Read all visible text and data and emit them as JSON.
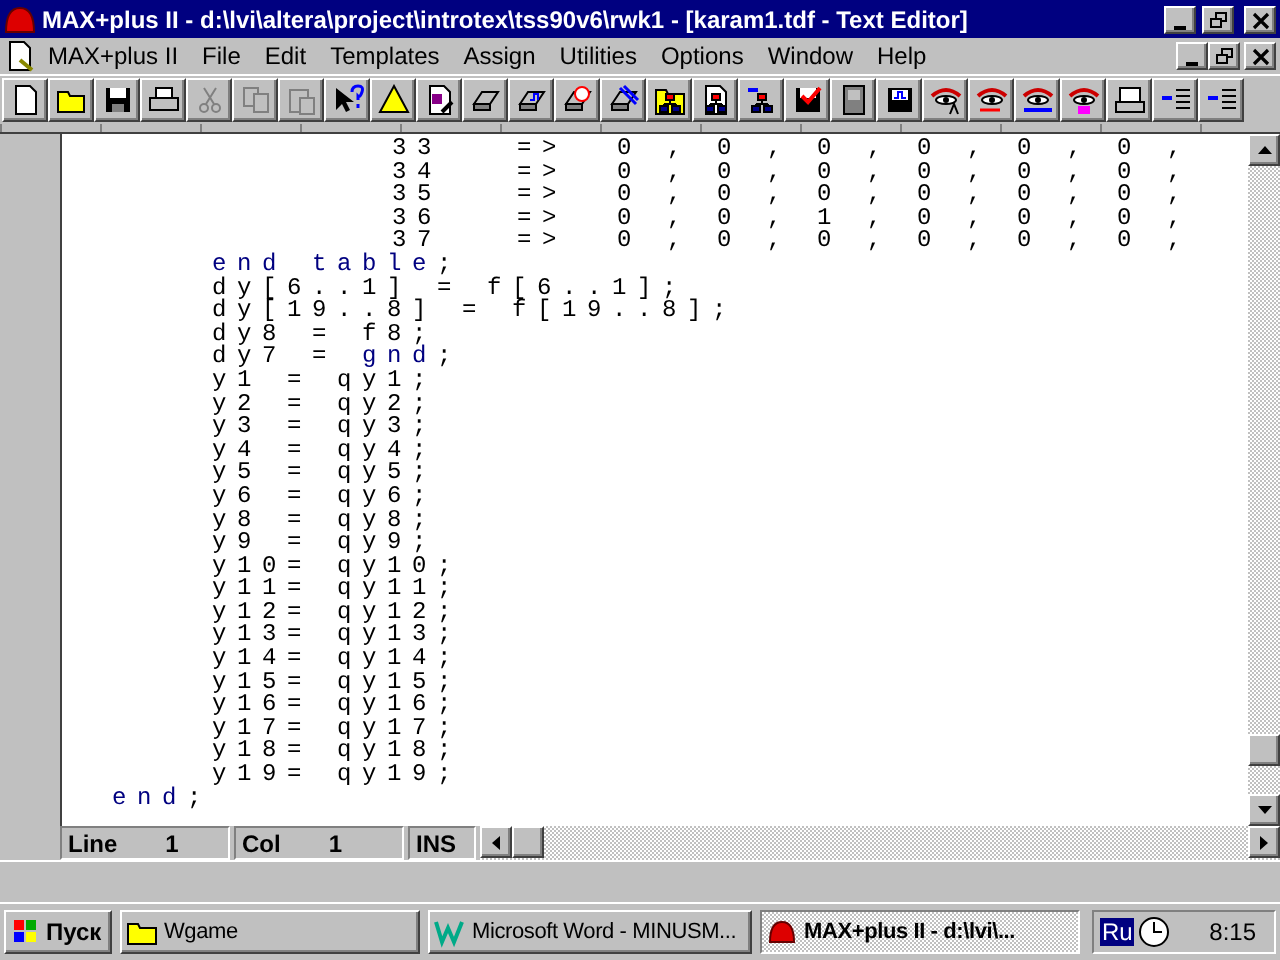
{
  "window": {
    "title": "MAX+plus II - d:\\lvi\\altera\\project\\introtex\\tss90v6\\rwk1 - [karam1.tdf - Text Editor]"
  },
  "menu": [
    "MAX+plus II",
    "File",
    "Edit",
    "Templates",
    "Assign",
    "Utilities",
    "Options",
    "Window",
    "Help"
  ],
  "editor": {
    "lines": [
      {
        "kind": "row",
        "segments": [
          {
            "text": "33   =>  0 , 0 , 0 , 0 , 0 , 0 ,",
            "keyword": false
          }
        ]
      },
      {
        "kind": "row",
        "segments": [
          {
            "text": "34   =>  0 , 0 , 0 , 0 , 0 , 0 ,",
            "keyword": false
          }
        ]
      },
      {
        "kind": "row",
        "segments": [
          {
            "text": "35   =>  0 , 0 , 0 , 0 , 0 , 0 ,",
            "keyword": false
          }
        ]
      },
      {
        "kind": "row",
        "segments": [
          {
            "text": "36   =>  0 , 0 , 1 , 0 , 0 , 0 ,",
            "keyword": false
          }
        ]
      },
      {
        "kind": "row",
        "segments": [
          {
            "text": "37   =>  0 , 0 , 0 , 0 , 0 , 0 ,",
            "keyword": false
          }
        ]
      },
      {
        "kind": "body",
        "segments": [
          {
            "text": "end table",
            "keyword": true
          },
          {
            "text": ";",
            "keyword": false
          }
        ]
      },
      {
        "kind": "body",
        "segments": [
          {
            "text": "dy[6..1] = f[6..1];",
            "keyword": false
          }
        ]
      },
      {
        "kind": "body",
        "segments": [
          {
            "text": "dy[19..8] = f[19..8];",
            "keyword": false
          }
        ]
      },
      {
        "kind": "body",
        "segments": [
          {
            "text": "dy8 = f8;",
            "keyword": false
          }
        ]
      },
      {
        "kind": "body",
        "segments": [
          {
            "text": "dy7 = ",
            "keyword": false
          },
          {
            "text": "gnd",
            "keyword": true
          },
          {
            "text": ";",
            "keyword": false
          }
        ]
      },
      {
        "kind": "body",
        "segments": [
          {
            "text": "y1 = qy1;",
            "keyword": false
          }
        ]
      },
      {
        "kind": "body",
        "segments": [
          {
            "text": "y2 = qy2;",
            "keyword": false
          }
        ]
      },
      {
        "kind": "body",
        "segments": [
          {
            "text": "y3 = qy3;",
            "keyword": false
          }
        ]
      },
      {
        "kind": "body",
        "segments": [
          {
            "text": "y4 = qy4;",
            "keyword": false
          }
        ]
      },
      {
        "kind": "body",
        "segments": [
          {
            "text": "y5 = qy5;",
            "keyword": false
          }
        ]
      },
      {
        "kind": "body",
        "segments": [
          {
            "text": "y6 = qy6;",
            "keyword": false
          }
        ]
      },
      {
        "kind": "body",
        "segments": [
          {
            "text": "y8 = qy8;",
            "keyword": false
          }
        ]
      },
      {
        "kind": "body",
        "segments": [
          {
            "text": "y9 = qy9;",
            "keyword": false
          }
        ]
      },
      {
        "kind": "body",
        "segments": [
          {
            "text": "y10= qy10;",
            "keyword": false
          }
        ]
      },
      {
        "kind": "body",
        "segments": [
          {
            "text": "y11= qy11;",
            "keyword": false
          }
        ]
      },
      {
        "kind": "body",
        "segments": [
          {
            "text": "y12= qy12;",
            "keyword": false
          }
        ]
      },
      {
        "kind": "body",
        "segments": [
          {
            "text": "y13= qy13;",
            "keyword": false
          }
        ]
      },
      {
        "kind": "body",
        "segments": [
          {
            "text": "y14= qy14;",
            "keyword": false
          }
        ]
      },
      {
        "kind": "body",
        "segments": [
          {
            "text": "y15= qy15;",
            "keyword": false
          }
        ]
      },
      {
        "kind": "body",
        "segments": [
          {
            "text": "y16= qy16;",
            "keyword": false
          }
        ]
      },
      {
        "kind": "body",
        "segments": [
          {
            "text": "y17= qy17;",
            "keyword": false
          }
        ]
      },
      {
        "kind": "body",
        "segments": [
          {
            "text": "y18= qy18;",
            "keyword": false
          }
        ]
      },
      {
        "kind": "body",
        "segments": [
          {
            "text": "y19= qy19;",
            "keyword": false
          }
        ]
      },
      {
        "kind": "outer",
        "segments": [
          {
            "text": "end",
            "keyword": true
          },
          {
            "text": ";",
            "keyword": false
          }
        ]
      }
    ]
  },
  "status": [
    {
      "label": "Line",
      "value": "1"
    },
    {
      "label": "Col",
      "value": "1"
    },
    {
      "label": "INS"
    }
  ],
  "taskbar": {
    "start": "Пуск",
    "tasks": [
      {
        "label": "Wgame",
        "kind": "folder",
        "selected": false
      },
      {
        "label": "Microsoft Word - MINUSM...",
        "kind": "word",
        "selected": false
      },
      {
        "label": "MAX+plus II - d:\\lvi\\...",
        "kind": "app",
        "selected": true
      }
    ],
    "language": "Ru",
    "time": "8:15"
  }
}
